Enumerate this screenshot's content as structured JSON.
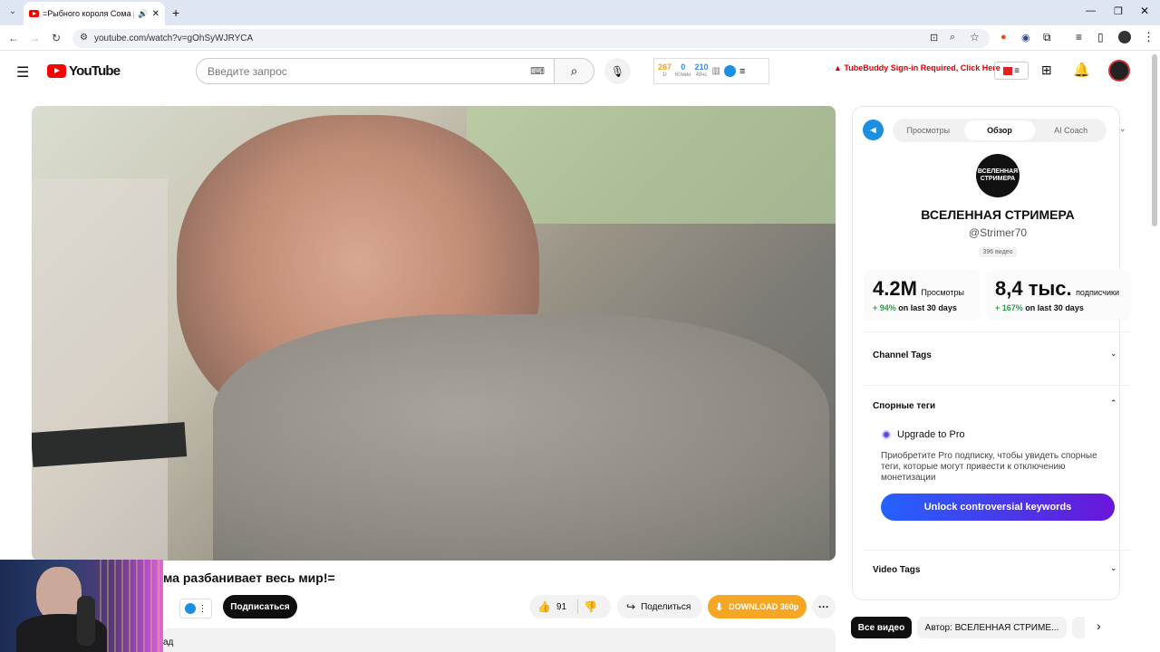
{
  "browser": {
    "tab_title": "=Рыбного короля Сома р",
    "url": "youtube.com/watch?v=gOhSyWJRYCA"
  },
  "yt": {
    "logo": "YouTube",
    "search_placeholder": "Введите запрос"
  },
  "ext_stats": [
    {
      "value": "267",
      "label": "1г",
      "color": "#f0a020"
    },
    {
      "value": "0",
      "label": "60мин",
      "color": "#3a8be0"
    },
    {
      "value": "210",
      "label": "48чс",
      "color": "#3a8be0"
    }
  ],
  "tubebuddy": {
    "warning": "TubeBuddy Sign-in Required, Click Here"
  },
  "panel": {
    "tabs": [
      "Просмотры",
      "Обзор",
      "AI Coach"
    ],
    "channel_logo_text": "ВСЕЛЕННАЯ СТРИМЕРА",
    "channel_name": "ВСЕЛЕННАЯ СТРИМЕРА",
    "handle": "@Strimer70",
    "video_count": "396 видео",
    "views": {
      "value": "4.2M",
      "label": "Просмотры",
      "growth": "+ 94%",
      "period": "on last 30 days"
    },
    "subs": {
      "value": "8,4 тыс.",
      "label": "подписчики",
      "growth": "+ 167%",
      "period": "on last 30 days"
    },
    "channel_tags": "Channel Tags",
    "controversial_tags": "Спорные теги",
    "upgrade_title": "Upgrade to Pro",
    "upgrade_text": "Приобретите Pro подписку, чтобы увидеть спорные теги, которые могут привести к отключению монетизации",
    "unlock_button": "Unlock controversial keywords",
    "video_tags": "Video Tags"
  },
  "video": {
    "title": "ма разбанивает весь мир!=",
    "subscribe": "Подписаться",
    "likes": "91",
    "share": "Поделиться",
    "download": "DOWNLOAD 360p",
    "desc_fragment": "ад"
  },
  "chips": [
    "Все видео",
    "Автор: ВСЕЛЕННАЯ СТРИМЕ..."
  ]
}
